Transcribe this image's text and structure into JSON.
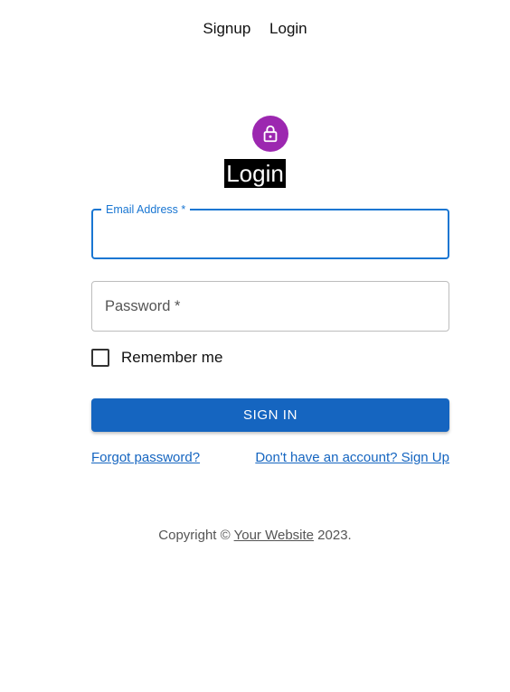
{
  "nav": {
    "signup": "Signup",
    "login": "Login"
  },
  "form": {
    "icon": "lock-icon",
    "title": "Login",
    "email": {
      "label": "Email Address *",
      "value": ""
    },
    "password": {
      "label": "Password *",
      "value": ""
    },
    "remember_label": "Remember me",
    "remember_checked": false,
    "submit_label": "SIGN IN",
    "forgot_link": "Forgot password?",
    "signup_link": "Don't have an account? Sign Up"
  },
  "footer": {
    "prefix": "Copyright © ",
    "site_link": "Your Website",
    "suffix": " 2023."
  },
  "colors": {
    "primary": "#1976d2",
    "avatar": "#9c27b0",
    "button": "#1565c0"
  }
}
